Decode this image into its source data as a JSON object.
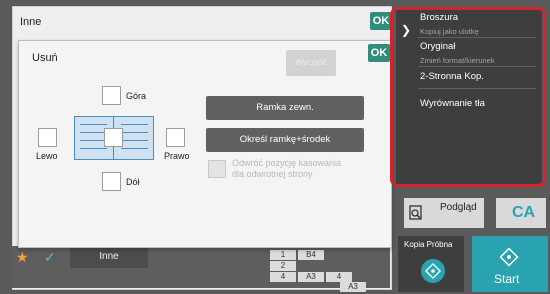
{
  "back_window": {
    "title": "Inne",
    "ok_label": "OK"
  },
  "dialog": {
    "title": "Usuń",
    "ok_label": "OK",
    "disabled_button": "Wyczyść",
    "top_label": "Góra",
    "left_label": "Lewo",
    "right_label": "Prawo",
    "bottom_label": "Dół",
    "frame_button": "Ramka zewn.",
    "frame_center_button": "Określ ramkę+środek",
    "reverse_label_line1": "Odwróć pozycję kasowania",
    "reverse_label_line2": "dla odwrotnej strony"
  },
  "bottom_bar": {
    "tab_label": "Inne",
    "mini": {
      "b4": "B4",
      "n4a": "4",
      "a3a": "A3",
      "n1": "1",
      "n2": "2",
      "n4b": "4",
      "a3b": "A3"
    }
  },
  "right_panel": {
    "items": [
      {
        "title": "Broszura",
        "subtitle": "Kopiuj jako ulotkę"
      },
      {
        "title": "Oryginał",
        "subtitle": "Zmień format/kierunek"
      },
      {
        "title": "2-Stronna Kop.",
        "subtitle": ""
      },
      {
        "title": "Wyrównanie tła",
        "subtitle": ""
      }
    ]
  },
  "actions": {
    "preview": "Podgląd",
    "ca": "CA",
    "proof_copy": "Kopia Próbna",
    "start": "Start"
  },
  "colors": {
    "accent_ok": "#2f8e7a",
    "highlight": "#d4232f",
    "start": "#2aa3b0",
    "ca": "#2aa3b0"
  },
  "icons": [
    "star-icon",
    "check-icon",
    "chevron-right-icon",
    "preview-icon",
    "start-icon",
    "proof-icon"
  ]
}
